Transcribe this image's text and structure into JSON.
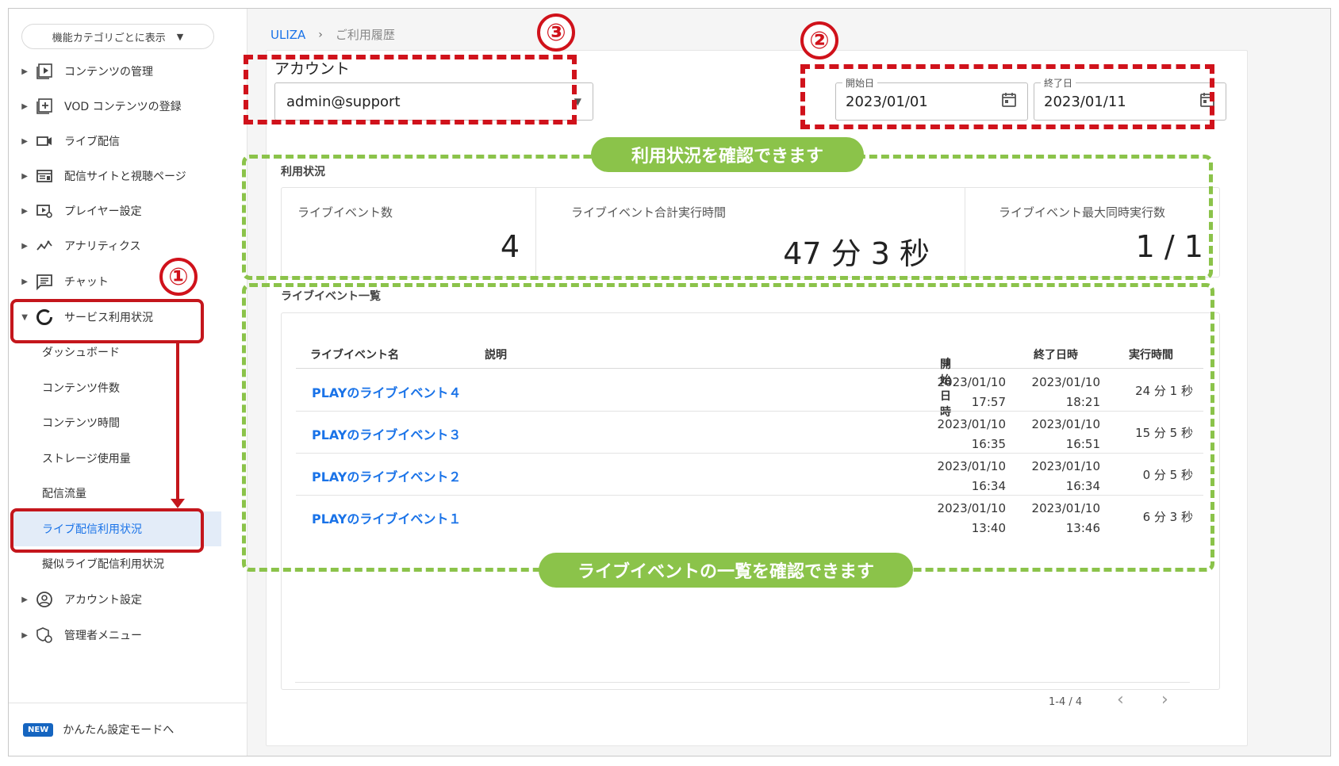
{
  "sidebar": {
    "category_select": "機能カテゴリごとに表示",
    "items": [
      {
        "label": "コンテンツの管理"
      },
      {
        "label": "VOD コンテンツの登録"
      },
      {
        "label": "ライブ配信"
      },
      {
        "label": "配信サイトと視聴ページ"
      },
      {
        "label": "プレイヤー設定"
      },
      {
        "label": "アナリティクス"
      },
      {
        "label": "チャット"
      },
      {
        "label": "サービス利用状況"
      }
    ],
    "sub_items": [
      {
        "label": "ダッシュボード"
      },
      {
        "label": "コンテンツ件数"
      },
      {
        "label": "コンテンツ時間"
      },
      {
        "label": "ストレージ使用量"
      },
      {
        "label": "配信流量"
      },
      {
        "label": "ライブ配信利用状況"
      },
      {
        "label": "擬似ライブ配信利用状況"
      }
    ],
    "items_after": [
      {
        "label": "アカウント設定"
      },
      {
        "label": "管理者メニュー"
      }
    ],
    "new_badge": "NEW",
    "easy_mode_link": "かんたん設定モードへ"
  },
  "breadcrumb": {
    "root": "ULIZA",
    "separator": "›",
    "current": "ご利用履歴"
  },
  "account": {
    "label": "アカウント",
    "value": "admin@support"
  },
  "date_range": {
    "start_label": "開始日",
    "start_value": "2023/01/01",
    "end_label": "終了日",
    "end_value": "2023/01/11"
  },
  "usage": {
    "title": "利用状況",
    "stats": [
      {
        "label": "ライブイベント数",
        "value": "4"
      },
      {
        "label": "ライブイベント合計実行時間",
        "value": "47 分 3 秒"
      },
      {
        "label": "ライブイベント最大同時実行数",
        "value": "1 / 1"
      }
    ]
  },
  "event_list": {
    "title": "ライブイベント一覧",
    "columns": {
      "name": "ライブイベント名",
      "description": "説明",
      "start": "開始日時",
      "sort_indicator": "↓",
      "end": "終了日時",
      "duration": "実行時間"
    },
    "rows": [
      {
        "name": "PLAYのライブイベント４",
        "start_date": "2023/01/10",
        "start_time": "17:57",
        "end_date": "2023/01/10",
        "end_time": "18:21",
        "duration": "24 分 1 秒"
      },
      {
        "name": "PLAYのライブイベント３",
        "start_date": "2023/01/10",
        "start_time": "16:35",
        "end_date": "2023/01/10",
        "end_time": "16:51",
        "duration": "15 分 5 秒"
      },
      {
        "name": "PLAYのライブイベント２",
        "start_date": "2023/01/10",
        "start_time": "16:34",
        "end_date": "2023/01/10",
        "end_time": "16:34",
        "duration": "0 分 5 秒"
      },
      {
        "name": "PLAYのライブイベント１",
        "start_date": "2023/01/10",
        "start_time": "13:40",
        "end_date": "2023/01/10",
        "end_time": "13:46",
        "duration": "6 分 3 秒"
      }
    ],
    "pagination": "1-4 / 4",
    "prev": "‹",
    "next": "›"
  },
  "annotations": {
    "badge_1": "①",
    "badge_2": "②",
    "badge_3": "③",
    "usage_callout": "利用状況を確認できます",
    "list_callout": "ライブイベントの一覧を確認できます",
    "red_color": "#d0121b",
    "green_color": "#8bc34a"
  },
  "colors": {
    "link": "#1a73e8",
    "active_bg": "#e3ecf8",
    "new_badge": "#1565c0"
  }
}
